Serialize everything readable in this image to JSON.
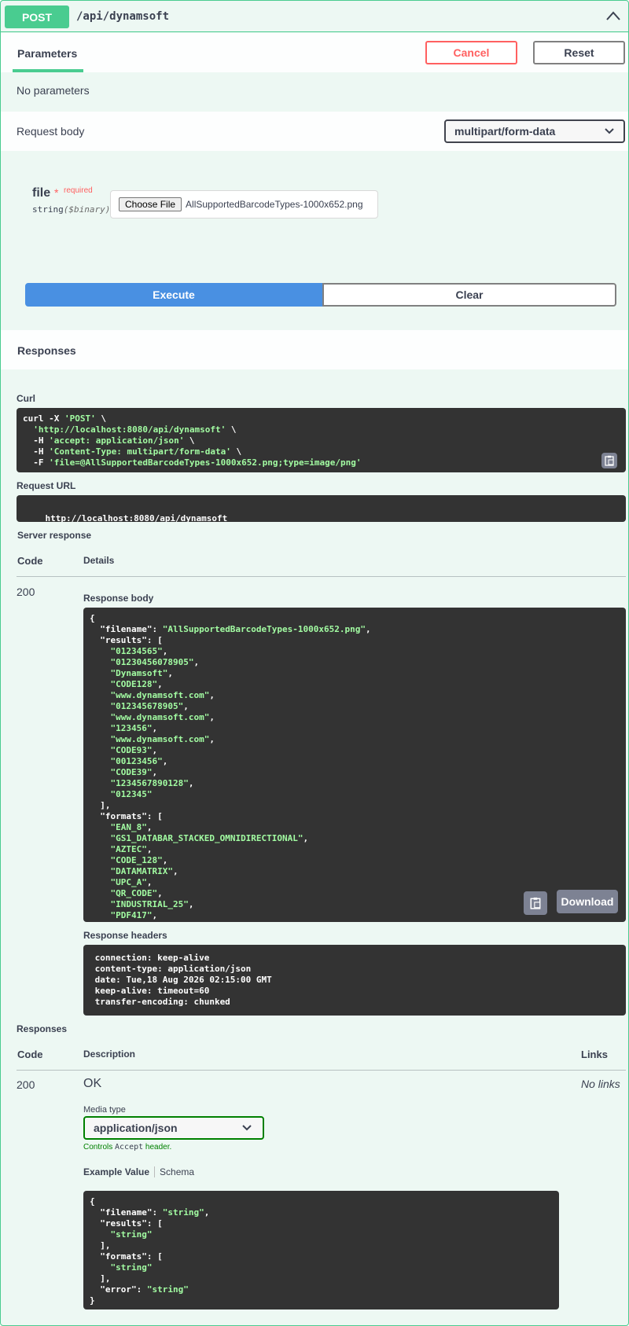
{
  "operation": {
    "method": "POST",
    "path": "/api/dynamsoft"
  },
  "params_section": {
    "tab_label": "Parameters",
    "cancel_label": "Cancel",
    "reset_label": "Reset",
    "no_params_text": "No parameters"
  },
  "request_body": {
    "label": "Request body",
    "content_type": "multipart/form-data",
    "field_name": "file",
    "required_star": "*",
    "required_text": "required",
    "type_label": "string",
    "type_format": "($binary)",
    "choose_file_label": "Choose File",
    "file_name": "AllSupportedBarcodeTypes-1000x652.png"
  },
  "actions": {
    "execute_label": "Execute",
    "clear_label": "Clear"
  },
  "responses_section": {
    "title": "Responses",
    "curl_label": "Curl",
    "curl_lines": [
      {
        "prefix": "curl -X ",
        "str": "'POST'",
        "suffix": " \\"
      },
      {
        "prefix": "  ",
        "str": "'http://localhost:8080/api/dynamsoft'",
        "suffix": " \\"
      },
      {
        "prefix": "  -H ",
        "str": "'accept: application/json'",
        "suffix": " \\"
      },
      {
        "prefix": "  -H ",
        "str": "'Content-Type: multipart/form-data'",
        "suffix": " \\"
      },
      {
        "prefix": "  -F ",
        "str": "'file=@AllSupportedBarcodeTypes-1000x652.png;type=image/png'",
        "suffix": ""
      }
    ],
    "request_url_label": "Request URL",
    "request_url": "http://localhost:8080/api/dynamsoft",
    "server_response_label": "Server response",
    "code_header": "Code",
    "details_header": "Details",
    "status_code": "200",
    "response_body_label": "Response body",
    "response_body_lines": [
      {
        "k": "",
        "v": "{"
      },
      {
        "k": "  \"filename\": ",
        "s": "\"AllSupportedBarcodeTypes-1000x652.png\"",
        "t": ","
      },
      {
        "k": "  \"results\": [",
        "v": ""
      },
      {
        "k": "    ",
        "s": "\"01234565\"",
        "t": ","
      },
      {
        "k": "    ",
        "s": "\"01230456078905\"",
        "t": ","
      },
      {
        "k": "    ",
        "s": "\"Dynamsoft\"",
        "t": ","
      },
      {
        "k": "    ",
        "s": "\"CODE128\"",
        "t": ","
      },
      {
        "k": "    ",
        "s": "\"www.dynamsoft.com\"",
        "t": ","
      },
      {
        "k": "    ",
        "s": "\"012345678905\"",
        "t": ","
      },
      {
        "k": "    ",
        "s": "\"www.dynamsoft.com\"",
        "t": ","
      },
      {
        "k": "    ",
        "s": "\"123456\"",
        "t": ","
      },
      {
        "k": "    ",
        "s": "\"www.dynamsoft.com\"",
        "t": ","
      },
      {
        "k": "    ",
        "s": "\"CODE93\"",
        "t": ","
      },
      {
        "k": "    ",
        "s": "\"00123456\"",
        "t": ","
      },
      {
        "k": "    ",
        "s": "\"CODE39\"",
        "t": ","
      },
      {
        "k": "    ",
        "s": "\"1234567890128\"",
        "t": ","
      },
      {
        "k": "    ",
        "s": "\"012345\"",
        "t": ""
      },
      {
        "k": "  ],",
        "v": ""
      },
      {
        "k": "  \"formats\": [",
        "v": ""
      },
      {
        "k": "    ",
        "s": "\"EAN_8\"",
        "t": ","
      },
      {
        "k": "    ",
        "s": "\"GS1_DATABAR_STACKED_OMNIDIRECTIONAL\"",
        "t": ","
      },
      {
        "k": "    ",
        "s": "\"AZTEC\"",
        "t": ","
      },
      {
        "k": "    ",
        "s": "\"CODE_128\"",
        "t": ","
      },
      {
        "k": "    ",
        "s": "\"DATAMATRIX\"",
        "t": ","
      },
      {
        "k": "    ",
        "s": "\"UPC_A\"",
        "t": ","
      },
      {
        "k": "    ",
        "s": "\"QR_CODE\"",
        "t": ","
      },
      {
        "k": "    ",
        "s": "\"INDUSTRIAL_25\"",
        "t": ","
      },
      {
        "k": "    ",
        "s": "\"PDF417\"",
        "t": ","
      }
    ],
    "download_label": "Download",
    "response_headers_label": "Response headers",
    "response_headers": [
      " connection: keep-alive ",
      " content-type: application/json ",
      " date: Tue,18 Aug 2026 02:15:00 GMT ",
      " keep-alive: timeout=60 ",
      " transfer-encoding: chunked "
    ]
  },
  "documented_responses": {
    "title": "Responses",
    "code_header": "Code",
    "description_header": "Description",
    "links_header": "Links",
    "code": "200",
    "description": "OK",
    "links": "No links",
    "media_type_label": "Media type",
    "media_type": "application/json",
    "controls_prefix": "Controls ",
    "controls_mono": "Accept",
    "controls_suffix": " header.",
    "example_value_tab": "Example Value",
    "schema_tab": "Schema",
    "example_lines": [
      {
        "k": "{",
        "s": "",
        "t": ""
      },
      {
        "k": "  \"filename\": ",
        "s": "\"string\"",
        "t": ","
      },
      {
        "k": "  \"results\": [",
        "s": "",
        "t": ""
      },
      {
        "k": "    ",
        "s": "\"string\"",
        "t": ""
      },
      {
        "k": "  ],",
        "s": "",
        "t": ""
      },
      {
        "k": "  \"formats\": [",
        "s": "",
        "t": ""
      },
      {
        "k": "    ",
        "s": "\"string\"",
        "t": ""
      },
      {
        "k": "  ],",
        "s": "",
        "t": ""
      },
      {
        "k": "  \"error\": ",
        "s": "\"string\"",
        "t": ""
      },
      {
        "k": "}",
        "s": "",
        "t": ""
      }
    ]
  },
  "colors": {
    "post_green": "#49cc90",
    "execute_blue": "#4990e2",
    "cancel_red": "#ff6060",
    "code_bg": "#333333",
    "string_green": "#a2fca2"
  }
}
